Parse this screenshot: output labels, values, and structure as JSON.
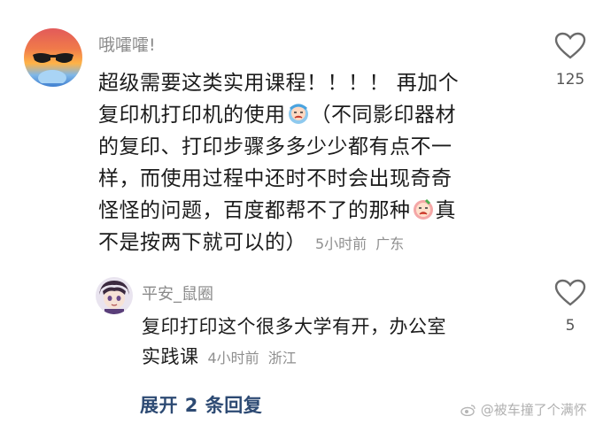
{
  "comment": {
    "username": "哦嚯嚯!",
    "lines": [
      "超级需要这类实用课程！！！！ 再加个",
      "复印机打印机的使用",
      "（不同影印器材",
      "的复印、打印步骤多多少少都有点不一",
      "样，而使用过程中还时不时会出现奇奇",
      "怪怪的问题，百度都帮不了的那种",
      "真",
      "不是按两下就可以的）"
    ],
    "time": "5小时前",
    "location": "广东",
    "like_count": "125"
  },
  "reply": {
    "username": "平安_鼠圈",
    "lines": [
      "复印打印这个很多大学有开，办公室",
      "实践课"
    ],
    "time": "4小时前",
    "location": "浙江",
    "like_count": "5"
  },
  "expand_label": "展开 2 条回复",
  "watermark": "@被车撞了个满怀",
  "colors": {
    "link": "#2d4a73",
    "meta": "#8f8f8f"
  }
}
